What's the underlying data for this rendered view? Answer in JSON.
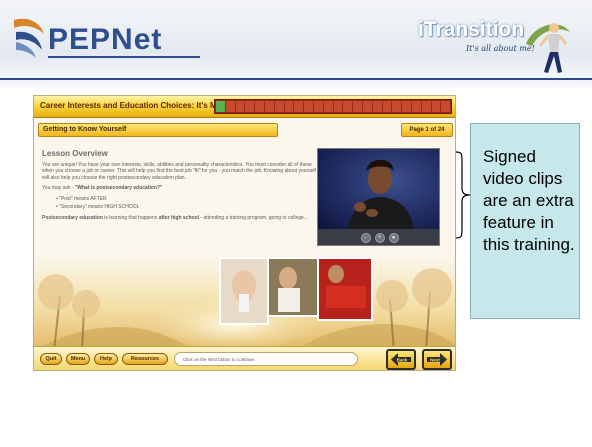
{
  "slide": {
    "logo_left": "PEPNet",
    "logo_right": "iTransition",
    "logo_right_tagline": "It's all about me!",
    "callout_text": "Signed video clips are an extra feature in this training."
  },
  "course": {
    "title": "Career Interests and Education Choices: It's My Plan!",
    "progress": {
      "completed_segments": 1,
      "total_segments": 24
    },
    "section_title": "Getting to Know Yourself",
    "page_label": "Page 1 of 24",
    "lesson": {
      "heading": "Lesson Overview",
      "paragraph1": "You are unique! You have your own interests, skills, abilities and personality characteristics. You must consider all of these when you choose a job or career. This will help you find the best job \"fit\" for you - you match the job. Knowing about yourself will also help you choose the right postsecondary education plan.",
      "question_prefix": "You may ask - ",
      "question": "\"What is postsecondary education?\"",
      "bullet1": "\"Post\" means AFTER",
      "bullet2": "\"Secondary\" means HIGH SCHOOL",
      "definition_term": "Postsecondary education",
      "definition_mid": " is learning that happens ",
      "definition_bold": "after high school",
      "definition_end": " - attending a training program, going to college..."
    },
    "video_controls": [
      "-",
      "+",
      "●"
    ],
    "footer": {
      "buttons": [
        "Quit",
        "Menu",
        "Help",
        "Resources"
      ],
      "hint": "Click on the Next button to continue.",
      "back_label": "Back",
      "next_label": "Next"
    }
  },
  "colors": {
    "brand_blue": "#2e4f8e",
    "course_gold": "#f2b51b",
    "callout_bg": "#c6e8eb"
  }
}
